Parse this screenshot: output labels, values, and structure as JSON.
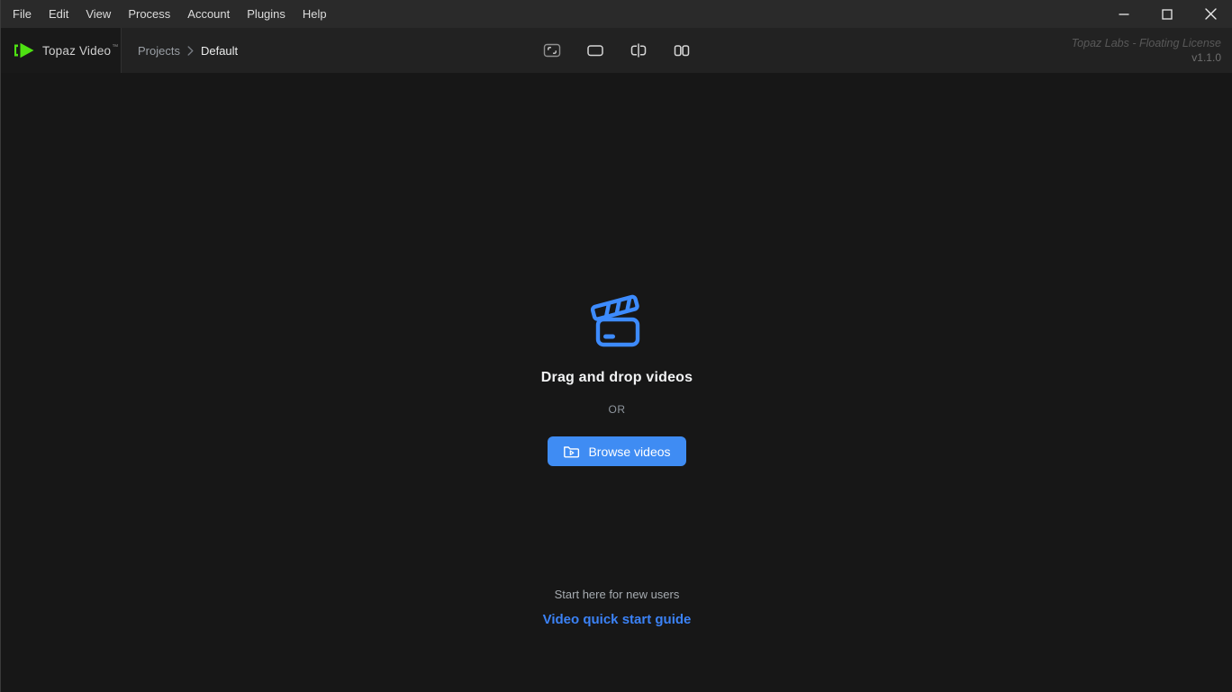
{
  "menubar": {
    "items": [
      "File",
      "Edit",
      "View",
      "Process",
      "Account",
      "Plugins",
      "Help"
    ],
    "window_controls": [
      "minimize",
      "maximize",
      "close"
    ]
  },
  "header": {
    "logo": {
      "text": "Topaz Video",
      "mark": "™"
    },
    "breadcrumb": {
      "root": "Projects",
      "separator": "›",
      "current": "Default"
    },
    "view_modes": [
      "fit-view",
      "single-view",
      "split-view",
      "side-by-side-view"
    ],
    "license": {
      "line1": "Topaz Labs - Floating License",
      "line2": "v1.1.0"
    }
  },
  "main": {
    "dropzone_title": "Drag and drop videos",
    "or_label": "OR",
    "browse_button_label": "Browse videos",
    "helper_text": "Start here for new users",
    "guide_link_label": "Video quick start guide"
  },
  "icons": {
    "logo": "green-play-icon",
    "dropzone": "clapperboard-icon",
    "browse_button": "folder-play-icon",
    "breadcrumb": "chevron-right-icon"
  },
  "colors": {
    "accent_blue": "#3f8cf3",
    "link_blue": "#3b82f6",
    "logo_green": "#4ee112",
    "menubar_bg": "#2a2a2a",
    "header_bg": "#222222",
    "main_bg": "#171717"
  }
}
